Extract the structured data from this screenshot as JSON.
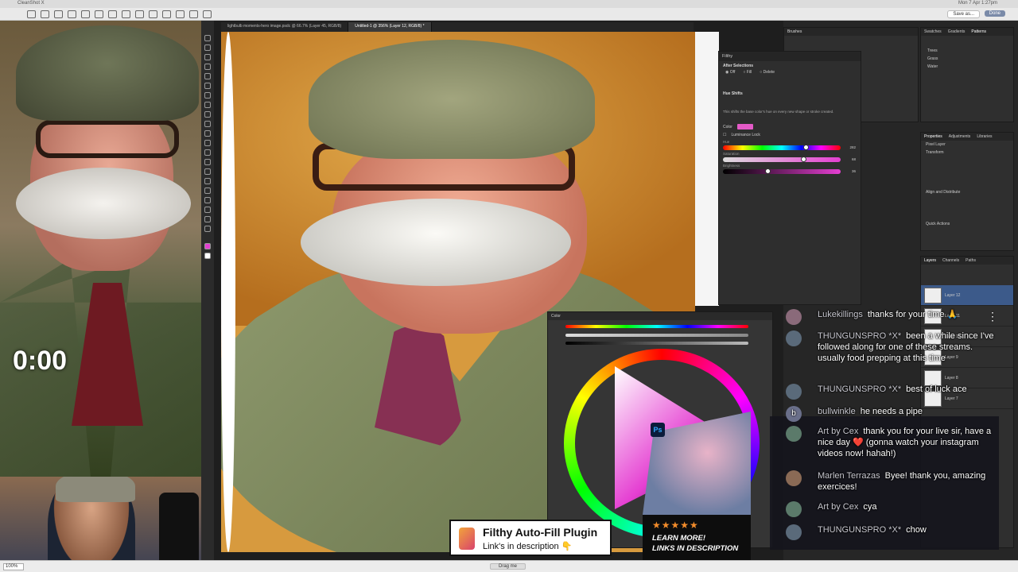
{
  "app": {
    "title": "CleanShot X",
    "clock": "Mon 7 Apr 1:27pm"
  },
  "topbar": {
    "save_as": "Save as...",
    "done": "Done"
  },
  "stream": {
    "timer": "0:00"
  },
  "doc_tabs": [
    {
      "label": "lightbulb moments-hero image.psdc @ 66.7% (Layer 45, RGB/8)"
    },
    {
      "label": "Untitled-1 @ 356% (Layer 12, RGB/8) *"
    }
  ],
  "filthy": {
    "title": "Filthy",
    "after_selections": "After Selections",
    "options": [
      "Off",
      "Fill",
      "Delete"
    ],
    "hue_shifts": "Hue Shifts",
    "hue_desc": "This shifts the base color's hue on every new shape or stroke created.",
    "color_label": "Color",
    "luminance_lock": "Luminance Lock",
    "hue_label": "Hue",
    "hue_value": "282",
    "saturation_label": "Saturation",
    "saturation_value": "68",
    "brightness_label": "Brightness",
    "brightness_value": "36",
    "colors": {
      "swatch": "#e45ac7"
    }
  },
  "panels": {
    "brushes": "Brushes",
    "swatches_tabs": [
      "Swatches",
      "Gradients",
      "Patterns"
    ],
    "swatch_items": [
      "Trees",
      "Grass",
      "Water"
    ],
    "properties_tabs": [
      "Properties",
      "Adjustments",
      "Libraries"
    ],
    "pixel_layer": "Pixel Layer",
    "transform": "Transform",
    "align": "Align and Distribute",
    "quick_actions": "Quick Actions",
    "layers_tabs": [
      "Layers",
      "Channels",
      "Paths"
    ],
    "layer_names": [
      "Layer 12",
      "Layer 11",
      "Layer 10",
      "Layer 9",
      "Layer 8",
      "Layer 7"
    ]
  },
  "color_panel": {
    "title": "Color"
  },
  "chat": [
    {
      "avatar": "",
      "author": "Lukekillings",
      "text": "thanks for your time 🙏"
    },
    {
      "avatar": "",
      "author": "THUNGUNSPRO *X*",
      "text": "been a while since I've followed along for one of these streams. usually food prepping at this time"
    },
    {
      "avatar": "",
      "author": "THUNGUNSPRO *X*",
      "text": "best of luck ace"
    },
    {
      "avatar": "b",
      "author": "bullwinkle",
      "text": "he needs a pipe"
    },
    {
      "avatar": "",
      "author": "Art by Cex",
      "text": "thank you for your live sir, have a nice day ❤️ (gonna watch your instagram videos now! hahah!)"
    },
    {
      "avatar": "",
      "author": "Marlen Terrazas",
      "text": "Byee! thank you, amazing exercices!"
    },
    {
      "avatar": "",
      "author": "Art by Cex",
      "text": "cya"
    },
    {
      "avatar": "",
      "author": "THUNGUNSPRO *X*",
      "text": "chow"
    }
  ],
  "plugin_banner": {
    "title": "Filthy Auto-Fill Plugin",
    "subtitle": "Link's in description 👇"
  },
  "promo": {
    "ps_label": "Ps",
    "stars": "★★★★★",
    "line1": "LEARN MORE!",
    "line2": "LINKS IN DESCRIPTION"
  },
  "statusbar": {
    "zoom": "100%",
    "drag": "Drag me"
  }
}
